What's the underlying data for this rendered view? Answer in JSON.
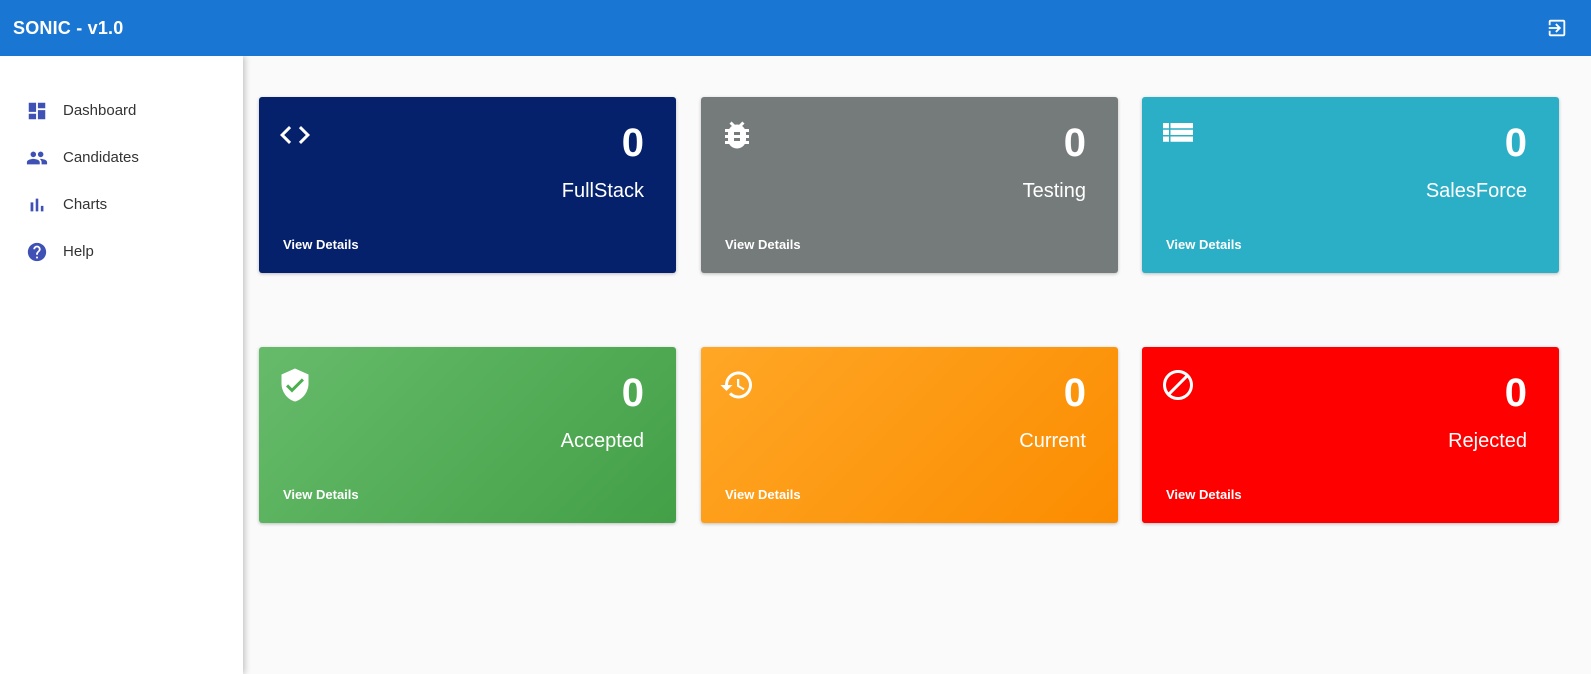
{
  "header": {
    "title": "SONIC - v1.0",
    "logout_icon": "logout-icon"
  },
  "sidebar": {
    "items": [
      {
        "label": "Dashboard",
        "icon": "dashboard-icon"
      },
      {
        "label": "Candidates",
        "icon": "people-icon"
      },
      {
        "label": "Charts",
        "icon": "bar-chart-icon"
      },
      {
        "label": "Help",
        "icon": "help-icon"
      }
    ],
    "icon_color": "#3f51b5"
  },
  "cards": [
    {
      "count": "0",
      "label": "FullStack",
      "link": "View Details",
      "icon": "code-icon",
      "color": "#05216b"
    },
    {
      "count": "0",
      "label": "Testing",
      "link": "View Details",
      "icon": "bug-icon",
      "color": "#757a7a"
    },
    {
      "count": "0",
      "label": "SalesForce",
      "link": "View Details",
      "icon": "list-icon",
      "color": "#2bafc6"
    },
    {
      "count": "0",
      "label": "Accepted",
      "link": "View Details",
      "icon": "shield-check-icon",
      "color": "#4caf50"
    },
    {
      "count": "0",
      "label": "Current",
      "link": "View Details",
      "icon": "history-icon",
      "color": "#fb8c00"
    },
    {
      "count": "0",
      "label": "Rejected",
      "link": "View Details",
      "icon": "block-icon",
      "color": "#ff0000"
    }
  ]
}
